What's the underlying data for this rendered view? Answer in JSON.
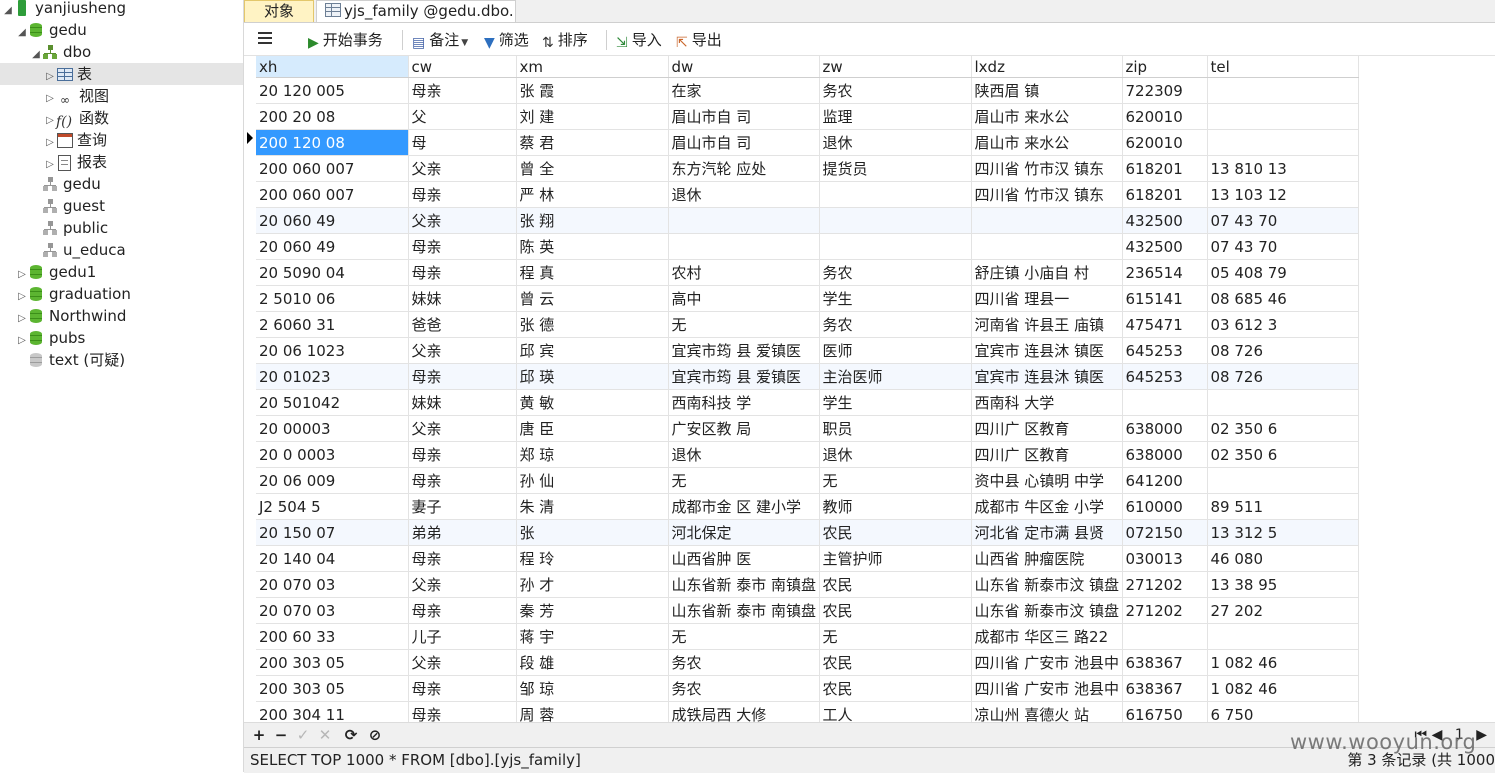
{
  "sidebar": {
    "nodes": [
      {
        "label": "yanjiusheng",
        "icon": "server-icon",
        "expanded": true
      },
      {
        "label": "gedu",
        "icon": "database-icon",
        "expanded": true
      },
      {
        "label": "dbo",
        "icon": "schema-icon",
        "expanded": true
      },
      {
        "label": "表",
        "icon": "table-icon",
        "selected": true
      },
      {
        "label": "视图",
        "icon": "view-icon"
      },
      {
        "label": "函数",
        "icon": "function-icon"
      },
      {
        "label": "查询",
        "icon": "query-icon"
      },
      {
        "label": "报表",
        "icon": "report-icon"
      },
      {
        "label": "gedu",
        "icon": "schema-icon"
      },
      {
        "label": "guest",
        "icon": "schema-icon"
      },
      {
        "label": "public",
        "icon": "schema-icon"
      },
      {
        "label": "u_educa",
        "icon": "schema-icon"
      },
      {
        "label": "gedu1",
        "icon": "database-icon"
      },
      {
        "label": "graduation",
        "icon": "database-icon"
      },
      {
        "label": "Northwind",
        "icon": "database-icon"
      },
      {
        "label": "pubs",
        "icon": "database-icon"
      },
      {
        "label": "text (可疑)",
        "icon": "database-icon"
      }
    ]
  },
  "tabs": {
    "objects": "对象",
    "table": "yjs_family @gedu.dbo..."
  },
  "toolbar": {
    "begin_transaction": "开始事务",
    "memo": "备注",
    "filter": "筛选",
    "sort": "排序",
    "import": "导入",
    "export": "导出"
  },
  "grid": {
    "columns": [
      "xh",
      "cw",
      "xm",
      "dw",
      "zw",
      "lxdz",
      "zip",
      "tel"
    ],
    "rows": [
      [
        "20  120  005",
        "母亲",
        "张  霞",
        "在家",
        "务农",
        "陕西眉   镇",
        "722309",
        ""
      ],
      [
        "200  20  08",
        "父",
        "刘  建",
        "眉山市自   司",
        "监理",
        "眉山市   来水公",
        "620010",
        ""
      ],
      [
        "200  120  08",
        "母",
        "蔡  君",
        "眉山市自   司",
        "退休",
        "眉山市   来水公",
        "620010",
        ""
      ],
      [
        "200  060  007",
        "父亲",
        "曾  全",
        "东方汽轮   应处",
        "提货员",
        "四川省   竹市汉   镇东",
        "618201",
        "13   810   13"
      ],
      [
        "200  060  007",
        "母亲",
        "严  林",
        "退休",
        "",
        "四川省   竹市汉   镇东",
        "618201",
        "13   103   12"
      ],
      [
        "20  060  49",
        "父亲",
        "张  翔",
        "",
        "",
        "",
        "432500",
        "07   43   70"
      ],
      [
        "20  060  49",
        "母亲",
        "陈  英",
        "",
        "",
        "",
        "432500",
        "07   43   70"
      ],
      [
        "20  5090  04",
        "母亲",
        "程  真",
        "农村",
        "务农",
        "舒庄镇   小庙自   村",
        "236514",
        "05   408   79"
      ],
      [
        "2  5010  06",
        "妹妹",
        "曾  云",
        "高中",
        "学生",
        "四川省   理县一",
        "615141",
        "08   685   46"
      ],
      [
        "2  6060  31",
        "爸爸",
        "张  德",
        "无",
        "务农",
        "河南省   许县王   庙镇",
        "475471",
        "03   612   3"
      ],
      [
        "20  06  1023",
        "父亲",
        "邱  宾",
        "宜宾市筠   县   爱镇医",
        "医师",
        "宜宾市   连县沐   镇医",
        "645253",
        "08   726"
      ],
      [
        "20  01023",
        "母亲",
        "邱  瑛",
        "宜宾市筠   县   爱镇医",
        "主治医师",
        "宜宾市   连县沐   镇医",
        "645253",
        "08   726"
      ],
      [
        "20  501042",
        "妹妹",
        "黄  敏",
        "西南科技   学",
        "学生",
        "西南科   大学",
        "",
        ""
      ],
      [
        "20  00003",
        "父亲",
        "唐  臣",
        "广安区教   局",
        "职员",
        "四川广   区教育",
        "638000",
        "02   350   6"
      ],
      [
        "20  0  0003",
        "母亲",
        "郑  琼",
        "退休",
        "退休",
        "四川广   区教育",
        "638000",
        "02   350   6"
      ],
      [
        "20  06  009",
        "母亲",
        "孙  仙",
        "无",
        "无",
        "资中县   心镇明   中学",
        "641200",
        ""
      ],
      [
        "J2  504  5",
        "妻子",
        "朱  清",
        "成都市金   区   建小学",
        "教师",
        "成都市   牛区金   小学",
        "610000",
        "89   511"
      ],
      [
        "20  150  07",
        "弟弟",
        "张",
        "河北保定",
        "农民",
        "河北省   定市满   县贤",
        "072150",
        "13   312   5"
      ],
      [
        "20  140  04",
        "母亲",
        "程  玲",
        "山西省肿   医",
        "主管护师",
        "山西省   肿瘤医院",
        "030013",
        "46   080"
      ],
      [
        "20  070  03",
        "父亲",
        "孙  才",
        "山东省新   泰市   南镇盘",
        "农民",
        "山东省   新泰市汶   镇盘",
        "271202",
        "13   38   95"
      ],
      [
        "20  070  03",
        "母亲",
        "秦  芳",
        "山东省新   泰市   南镇盘",
        "农民",
        "山东省   新泰市汶   镇盘",
        "271202",
        "27   202"
      ],
      [
        "200  60  33",
        "儿子",
        "蒋  宇",
        "无",
        "无",
        "成都市   华区三   路22",
        "",
        ""
      ],
      [
        "200  303  05",
        "父亲",
        "段  雄",
        "务农",
        "农民",
        "四川省   广安市   池县中",
        "638367",
        "1   082   46"
      ],
      [
        "200  303  05",
        "母亲",
        "邹  琼",
        "务农",
        "农民",
        "四川省   广安市   池县中",
        "638367",
        "1   082   46"
      ],
      [
        "200  304  11",
        "母亲",
        "周  蓉",
        "成铁局西   大修",
        "工人",
        "凉山州   喜德火   站",
        "616750",
        "6   750"
      ]
    ],
    "selected_row": 2,
    "selected_column": "xh"
  },
  "navbar": {
    "add": "+",
    "remove": "−",
    "apply": "✓",
    "cancel": "✕",
    "refresh": "⟳",
    "stop": "⊘",
    "page_number": "1"
  },
  "status": {
    "sql": "SELECT TOP 1000  * FROM [dbo].[yjs_family]",
    "record_info": "第 3 条记录 (共 1000"
  },
  "watermark": "www.wooyun.org",
  "colors": {
    "selection": "#3399ff",
    "header_selected": "#d6ebfd",
    "active_tab": "#fff3c4",
    "alt_row": "#f4f8fe"
  }
}
